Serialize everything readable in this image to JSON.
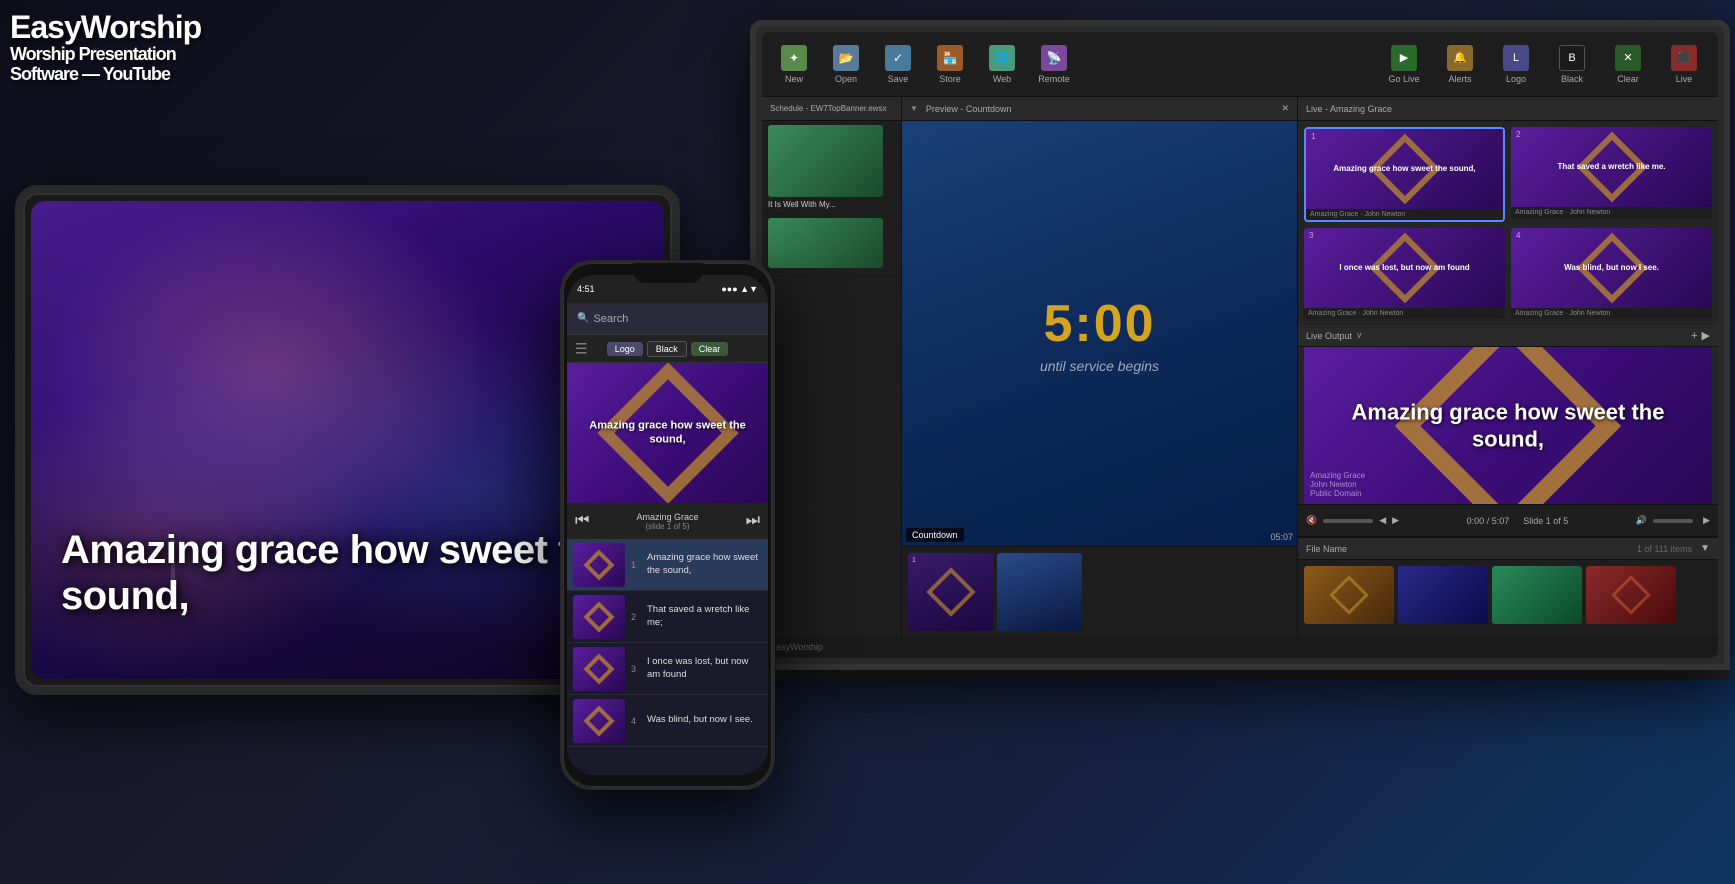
{
  "app": {
    "name": "EasyWorship",
    "tagline": "Worship Presentation Software",
    "logo_lines": [
      "EasyWorship",
      "Worship Presentation",
      "Software - YouTube"
    ]
  },
  "toolbar": {
    "new_label": "New",
    "open_label": "Open",
    "save_label": "Save",
    "store_label": "Store",
    "web_label": "Web",
    "remote_label": "Remote",
    "golive_label": "Go Live",
    "alerts_label": "Alerts",
    "logo_label": "Logo",
    "black_label": "Black",
    "clear_label": "Clear",
    "live_label": "Live"
  },
  "schedule": {
    "title": "Schedule - EW7TopBanner.ewsx"
  },
  "preview": {
    "title": "Preview - Countdown",
    "countdown_time": "5:00",
    "countdown_subtitle": "until service begins",
    "label": "Countdown",
    "time_display": "05:07"
  },
  "live": {
    "title": "Live - Amazing Grace",
    "song_title": "Amazing Grace",
    "song_author": "John Newton",
    "song_license": "Public Domain",
    "slide_indicator": "Slide 1 of 5",
    "time_display": "0:00 / 5:07",
    "slides": [
      {
        "num": "1",
        "text": "Amazing grace how sweet the sound,"
      },
      {
        "num": "2",
        "text": "That saved a wretch like me."
      },
      {
        "num": "3",
        "text": "I once was lost, but now am found"
      },
      {
        "num": "4",
        "text": "Was blind, but now I see."
      }
    ]
  },
  "tablet": {
    "overlay_text": "Amazing grace how sweet the sound,"
  },
  "phone": {
    "time": "4:51",
    "signal": "●●●",
    "wifi": "WiFi",
    "battery": "■",
    "search_placeholder": "Search",
    "song_display_text": "Amazing grace how sweet the sound,",
    "song_title": "Amazing Grace",
    "slide_info": "(slide 1 of 5)",
    "logo_btn": "Logo",
    "black_btn": "Black",
    "clear_btn": "Clear",
    "slides": [
      {
        "num": "1",
        "text": "Amazing grace how sweet the sound,",
        "active": true
      },
      {
        "num": "2",
        "text": "That saved a wretch like me;",
        "active": false
      },
      {
        "num": "3",
        "text": "I once was lost, but now am found",
        "active": false
      },
      {
        "num": "4",
        "text": "Was blind, but now I see.",
        "active": false
      }
    ]
  },
  "file_browser": {
    "header": "File Name",
    "count": "1 of 111 items"
  },
  "colors": {
    "accent_gold": "#d4a420",
    "purple_dark": "#2a0855",
    "purple_mid": "#5a1e9e",
    "blue_dark": "#0a2248",
    "toolbar_bg": "#1e1e1e",
    "panel_bg": "#252525"
  }
}
